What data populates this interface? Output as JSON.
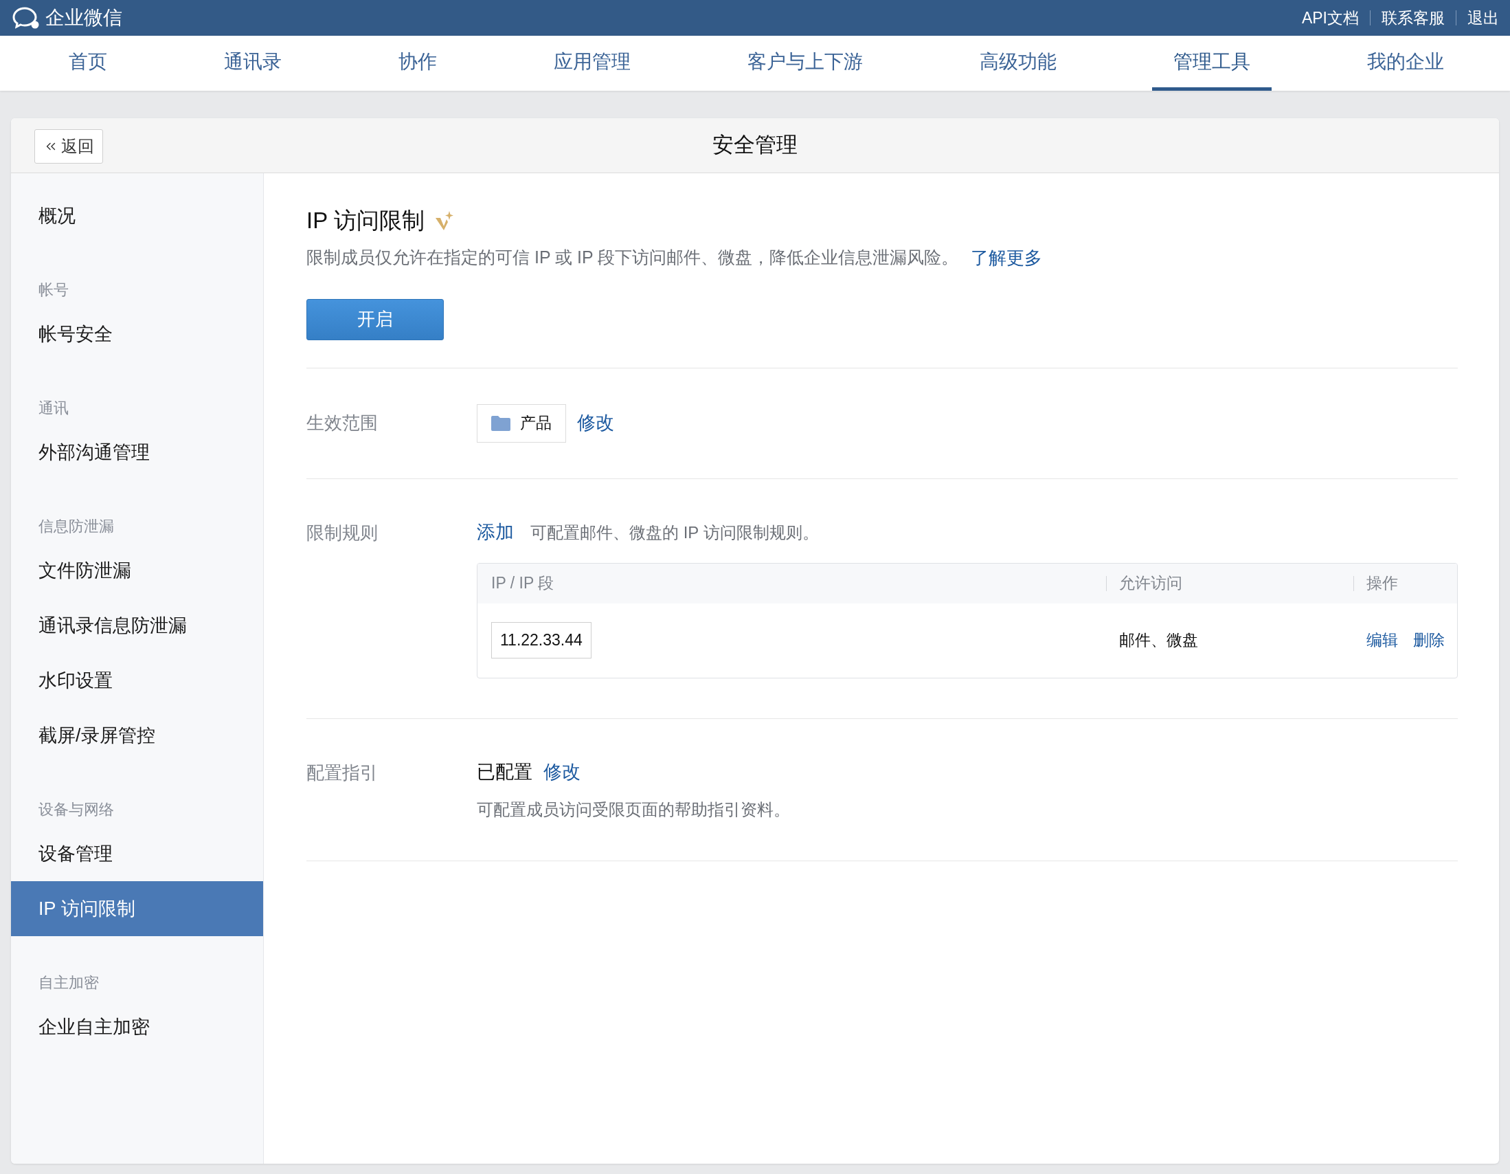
{
  "app": {
    "name": "企业微信"
  },
  "top_links": [
    "API文档",
    "联系客服",
    "退出"
  ],
  "nav": [
    {
      "label": "首页",
      "selected": false
    },
    {
      "label": "通讯录",
      "selected": false
    },
    {
      "label": "协作",
      "selected": false
    },
    {
      "label": "应用管理",
      "selected": false
    },
    {
      "label": "客户与上下游",
      "selected": false
    },
    {
      "label": "高级功能",
      "selected": false
    },
    {
      "label": "管理工具",
      "selected": true
    },
    {
      "label": "我的企业",
      "selected": false
    }
  ],
  "page": {
    "title": "安全管理",
    "back": "返回"
  },
  "sidebar": [
    {
      "items": [
        {
          "label": "概况",
          "selected": false
        }
      ]
    },
    {
      "heading": "帐号",
      "items": [
        {
          "label": "帐号安全",
          "selected": false
        }
      ]
    },
    {
      "heading": "通讯",
      "items": [
        {
          "label": "外部沟通管理",
          "selected": false
        }
      ]
    },
    {
      "heading": "信息防泄漏",
      "items": [
        {
          "label": "文件防泄漏",
          "selected": false
        },
        {
          "label": "通讯录信息防泄漏",
          "selected": false
        },
        {
          "label": "水印设置",
          "selected": false
        },
        {
          "label": "截屏/录屏管控",
          "selected": false
        }
      ]
    },
    {
      "heading": "设备与网络",
      "items": [
        {
          "label": "设备管理",
          "selected": false
        },
        {
          "label": "IP 访问限制",
          "selected": true
        }
      ]
    },
    {
      "heading": "自主加密",
      "items": [
        {
          "label": "企业自主加密",
          "selected": false
        }
      ]
    }
  ],
  "section": {
    "title": "IP 访问限制",
    "description": "限制成员仅允许在指定的可信 IP 或 IP 段下访问邮件、微盘，降低企业信息泄漏风险。",
    "learn_more": "了解更多",
    "enable_button": "开启"
  },
  "scope": {
    "label": "生效范围",
    "chip": "产品",
    "edit": "修改"
  },
  "rules": {
    "label": "限制规则",
    "add": "添加",
    "hint": "可配置邮件、微盘的 IP 访问限制规则。",
    "table": {
      "columns": [
        "IP / IP 段",
        "允许访问",
        "操作"
      ],
      "rows": [
        {
          "ip": "11.22.33.44",
          "access": "邮件、微盘",
          "actions": [
            "编辑",
            "删除"
          ]
        }
      ]
    }
  },
  "guide": {
    "label": "配置指引",
    "status": "已配置",
    "edit": "修改",
    "description": "可配置成员访问受限页面的帮助指引资料。"
  }
}
